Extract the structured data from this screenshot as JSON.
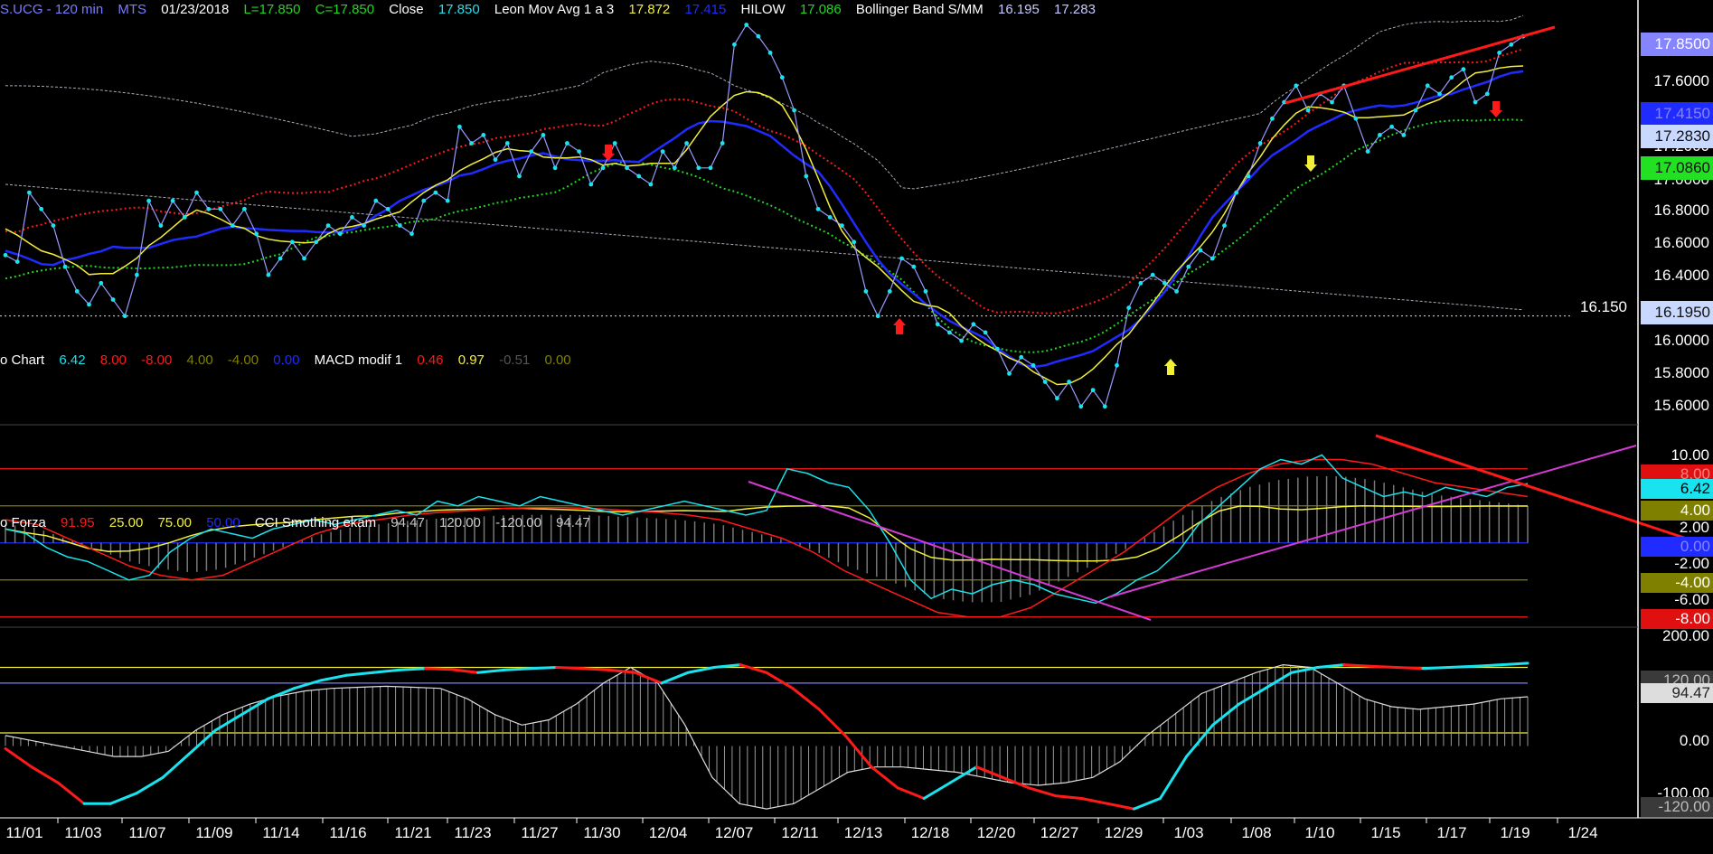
{
  "header_price": {
    "symbol": "S.UCG - 120 min",
    "source": "MTS",
    "date": "01/23/2018",
    "low": "L=17.850",
    "close_eq": "C=17.850",
    "close_word": "Close",
    "close_val": "17.850",
    "ma_name": "Leon Mov Avg 1 a 3",
    "ma_v1": "17.872",
    "ma_v2": "17.415",
    "hilow_name": "HILOW",
    "hilow_val": "17.086",
    "bb_name": "Bollinger Band S/MM",
    "bb_v1": "16.195",
    "bb_v2": "17.283"
  },
  "header_macd": {
    "prefix": "o Chart",
    "v1": "6.42",
    "v2": "8.00",
    "v3": "-8.00",
    "v4": "4.00",
    "v5": "-4.00",
    "v6": "0.00",
    "name": "MACD modif 1",
    "m1": "0.46",
    "m2": "0.97",
    "m3": "-0.51",
    "m4": "0.00"
  },
  "header_force": {
    "prefix": "o Forza",
    "v1": "91.95",
    "v2": "25.00",
    "v3": "75.00",
    "v4": "50.00",
    "name": "CCI Smothing ekam",
    "c1": "94.47",
    "c2": "120.00",
    "c3": "-120.00",
    "c4": "94.47"
  },
  "price_axis": {
    "ticks": [
      "17.6000",
      "17.2000",
      "17.0000",
      "16.8000",
      "16.6000",
      "16.4000",
      "16.0000",
      "15.8000",
      "15.6000"
    ],
    "last_price": "17.8500",
    "ma_fast": "17.4150",
    "bb_upper": "17.2830",
    "hilow_box": "17.0860",
    "bb_lower": "16.1950",
    "level_label": "16.150"
  },
  "macd_axis": {
    "ticks": [
      "10.00",
      "2.00",
      "-2.00",
      "-6.00"
    ],
    "box_red_top": "8.00",
    "box_cyan": "6.42",
    "box_olive_top": "4.00",
    "box_blue": "0.00",
    "box_olive_bot": "-4.00",
    "box_red_bot": "-8.00"
  },
  "cci_axis": {
    "ticks": [
      "200.00",
      "0.00",
      "-100.00"
    ],
    "box_120": "120.00",
    "box_last": "94.47",
    "box_neg120": "-120.00"
  },
  "x_labels": [
    "11/01",
    "11/03",
    "11/07",
    "11/09",
    "11/14",
    "11/16",
    "11/21",
    "11/23",
    "11/27",
    "11/30",
    "12/04",
    "12/07",
    "12/11",
    "12/13",
    "12/18",
    "12/20",
    "12/27",
    "12/29",
    "1/03",
    "1/08",
    "1/10",
    "1/15",
    "1/17",
    "1/19",
    "1/24"
  ],
  "colors": {
    "bg": "#000000",
    "cyan": "#19e3ee",
    "yellow": "#f2ef3a",
    "blue": "#1f2bff",
    "red": "#ff1a1a",
    "green": "#22d622",
    "magenta": "#d43bd4",
    "olive": "#808000",
    "gray": "#c8c8c8",
    "violet_text": "#7b7bff"
  },
  "chart_data": {
    "type": "line",
    "y_range_price": [
      15.5,
      17.95
    ],
    "y_range_macd": [
      -9,
      11
    ],
    "y_range_cci": [
      -125,
      225
    ],
    "price_close": [
      16.52,
      16.48,
      16.9,
      16.8,
      16.7,
      16.45,
      16.3,
      16.22,
      16.35,
      16.25,
      16.15,
      16.4,
      16.85,
      16.7,
      16.85,
      16.75,
      16.9,
      16.8,
      16.8,
      16.7,
      16.8,
      16.65,
      16.4,
      16.5,
      16.6,
      16.5,
      16.6,
      16.7,
      16.65,
      16.75,
      16.7,
      16.85,
      16.8,
      16.7,
      16.65,
      16.85,
      16.9,
      16.85,
      17.3,
      17.2,
      17.25,
      17.1,
      17.2,
      17.0,
      17.15,
      17.25,
      17.05,
      17.2,
      17.15,
      16.95,
      17.05,
      17.2,
      17.05,
      17.0,
      16.95,
      17.15,
      17.05,
      17.2,
      17.05,
      17.05,
      17.2,
      17.8,
      17.92,
      17.85,
      17.75,
      17.6,
      17.4,
      17.0,
      16.8,
      16.75,
      16.7,
      16.6,
      16.3,
      16.15,
      16.3,
      16.5,
      16.45,
      16.3,
      16.1,
      16.05,
      16.0,
      16.1,
      16.05,
      15.95,
      15.8,
      15.9,
      15.85,
      15.75,
      15.65,
      15.75,
      15.6,
      15.7,
      15.6,
      15.85,
      16.2,
      16.35,
      16.4,
      16.35,
      16.3,
      16.45,
      16.55,
      16.5,
      16.7,
      16.9,
      17.0,
      17.2,
      17.35,
      17.45,
      17.55,
      17.4,
      17.5,
      17.45,
      17.55,
      17.35,
      17.15,
      17.25,
      17.3,
      17.25,
      17.4,
      17.55,
      17.5,
      17.6,
      17.65,
      17.45,
      17.5,
      17.75,
      17.8,
      17.85
    ],
    "macd_cyan": [
      1.5,
      1.0,
      -0.5,
      -1.5,
      -2.0,
      -3.0,
      -4.0,
      -3.5,
      -1.0,
      0.5,
      1.5,
      1.0,
      0.5,
      1.5,
      2.0,
      2.5,
      2.0,
      2.5,
      3.0,
      3.5,
      3.0,
      4.5,
      4.0,
      5.0,
      4.5,
      4.0,
      5.0,
      4.5,
      4.0,
      3.5,
      3.0,
      3.5,
      4.0,
      4.5,
      4.0,
      3.5,
      3.0,
      3.5,
      8.0,
      7.5,
      6.5,
      6.0,
      3.5,
      0.0,
      -4.0,
      -6.0,
      -5.0,
      -5.5,
      -4.5,
      -4.0,
      -4.5,
      -5.5,
      -6.0,
      -6.5,
      -5.5,
      -4.0,
      -3.0,
      -1.0,
      2.0,
      4.0,
      6.0,
      8.0,
      9.0,
      8.5,
      9.5,
      7.0,
      6.0,
      5.0,
      5.5,
      5.0,
      6.0,
      5.5,
      5.0,
      6.0,
      6.4
    ],
    "macd_red": [
      2.5,
      2.0,
      0.5,
      -1.0,
      -2.5,
      -3.5,
      -4.0,
      -3.5,
      -2.0,
      -0.5,
      1.0,
      2.0,
      2.5,
      3.0,
      3.3,
      3.5,
      3.7,
      3.8,
      3.8,
      3.7,
      3.5,
      3.3,
      3.0,
      2.5,
      1.5,
      0.5,
      -1.0,
      -3.0,
      -4.5,
      -6.0,
      -7.5,
      -8.0,
      -8.0,
      -7.0,
      -5.0,
      -3.0,
      -1.0,
      1.5,
      4.0,
      6.0,
      7.5,
      8.5,
      9.0,
      9.0,
      8.5,
      7.5,
      6.5,
      6.0,
      5.5,
      5.0
    ],
    "cci_main": [
      -5,
      -40,
      -70,
      -110,
      -110,
      -90,
      -60,
      -15,
      30,
      60,
      90,
      110,
      125,
      135,
      140,
      145,
      148,
      146,
      140,
      145,
      148,
      150,
      148,
      145,
      140,
      120,
      140,
      150,
      155,
      140,
      110,
      70,
      20,
      -40,
      -80,
      -100,
      -70,
      -40,
      -60,
      -80,
      -95,
      -100,
      -110,
      -120,
      -100,
      -20,
      40,
      80,
      110,
      140,
      150,
      155,
      152,
      150,
      148,
      150,
      152,
      155,
      158
    ],
    "cci_signal": [
      20,
      10,
      0,
      -10,
      -20,
      -20,
      -10,
      30,
      60,
      80,
      95,
      105,
      110,
      112,
      114,
      112,
      110,
      90,
      60,
      40,
      50,
      80,
      120,
      150,
      120,
      40,
      -60,
      -110,
      -120,
      -110,
      -80,
      -50,
      -40,
      -40,
      -45,
      -50,
      -60,
      -70,
      -75,
      -70,
      -60,
      -30,
      20,
      60,
      100,
      120,
      140,
      155,
      150,
      120,
      90,
      75,
      70,
      75,
      80,
      90,
      94
    ],
    "trendlines": [
      {
        "panel": "price",
        "color": "red",
        "from": [
          "12/31",
          17.4
        ],
        "to": [
          "1/20",
          17.9
        ]
      },
      {
        "panel": "macd",
        "color": "red",
        "from": [
          "1/13",
          10.8
        ],
        "to": [
          "1/24",
          0.5
        ]
      },
      {
        "panel": "macd",
        "color": "magenta",
        "from": [
          "12/29",
          -6.0
        ],
        "to": [
          "1/24",
          10.2
        ]
      },
      {
        "panel": "macd",
        "color": "magenta",
        "from": [
          "12/07",
          8.5
        ],
        "to": [
          "12/27",
          -6.5
        ]
      }
    ]
  }
}
